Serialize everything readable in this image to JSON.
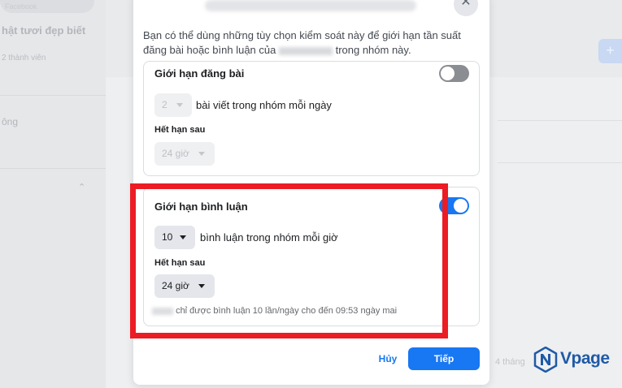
{
  "background": {
    "search_placeholder": "Facebook",
    "group_name": "hật tươi đẹp biết",
    "members": "2 thành viên",
    "nav_item": "ông",
    "plus_icon": "plus-icon",
    "timestamp": "4 tháng"
  },
  "modal": {
    "description_part1": "Bạn có thể dùng những tùy chọn kiểm soát này để giới hạn tần suất đăng bài hoặc bình luận của ",
    "description_part2": " trong nhóm này.",
    "close_icon": "close-icon",
    "post_limit": {
      "title": "Giới hạn đăng bài",
      "enabled": false,
      "count_value": "2",
      "count_suffix": "bài viết trong nhóm mỗi ngày",
      "expire_label": "Hết hạn sau",
      "expire_value": "24 giờ"
    },
    "comment_limit": {
      "title": "Giới hạn bình luận",
      "enabled": true,
      "count_value": "10",
      "count_suffix": "bình luận trong nhóm mỗi giờ",
      "expire_label": "Hết hạn sau",
      "expire_value": "24 giờ",
      "footnote": "chỉ được bình luận 10 lần/ngày cho đến 09:53 ngày mai"
    },
    "cancel_label": "Hủy",
    "next_label": "Tiếp"
  },
  "colors": {
    "accent": "#1877f2",
    "highlight": "#ec1c24",
    "logo": "#1f5aa6"
  },
  "watermark": {
    "text": "Vpage",
    "icon": "vpage-logo-icon"
  }
}
